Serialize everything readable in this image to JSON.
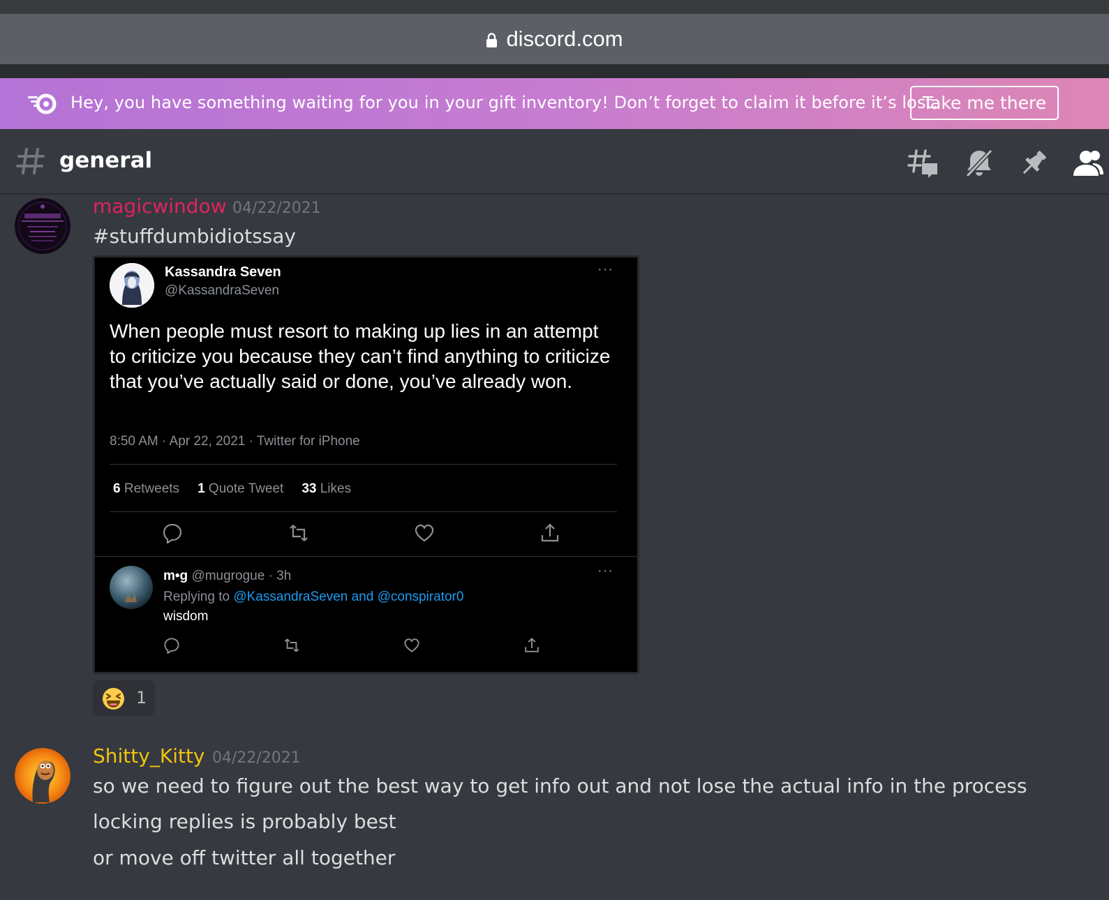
{
  "browser": {
    "url": "discord.com"
  },
  "banner": {
    "message": "Hey, you have something waiting for you in your gift inventory! Don’t forget to claim it before it’s lost.",
    "button_label": "Take me there"
  },
  "channel": {
    "name": "general",
    "header_icons": [
      "threads-icon",
      "mute-icon",
      "pin-icon",
      "members-icon"
    ]
  },
  "messages": [
    {
      "username": "magicwindow",
      "username_color": "#e0245e",
      "timestamp": "04/22/2021",
      "lines": [
        "#stuffdumbidiotssay"
      ],
      "embed": {
        "author_name": "Kassandra Seven",
        "author_handle": "@KassandraSeven",
        "more": "···",
        "body": "When people must resort to making up lies in an attempt to criticize you because they can’t find anything to criticize that you’ve actually said or done, you’ve already won.",
        "meta": "8:50 AM · Apr 22, 2021 · Twitter for iPhone",
        "stats": {
          "retweets_count": "6",
          "retweets_label": "Retweets",
          "quote_count": "1",
          "quote_label": "Quote Tweet",
          "likes_count": "33",
          "likes_label": "Likes"
        },
        "reply": {
          "name": "m•g",
          "handle_time": "@mugrogue · 3h",
          "replying_prefix": "Replying to",
          "replying_targets": "@KassandraSeven and @conspirator0",
          "text": "wisdom",
          "more": "···"
        }
      },
      "reaction": {
        "emoji": "laughing-emoji",
        "count": "1"
      }
    },
    {
      "username": "Shitty_Kitty",
      "username_color": "#f1c40f",
      "timestamp": "04/22/2021",
      "lines": [
        "so we need to figure out the best way to get info out and not lose the actual info in the process",
        "locking replies is probably best",
        "or move off twitter all together"
      ]
    }
  ],
  "colors": {
    "background": "#36393f",
    "banner_start": "#b473d6",
    "banner_end": "#dd86b5",
    "twitter_link": "#1d9bf0"
  }
}
